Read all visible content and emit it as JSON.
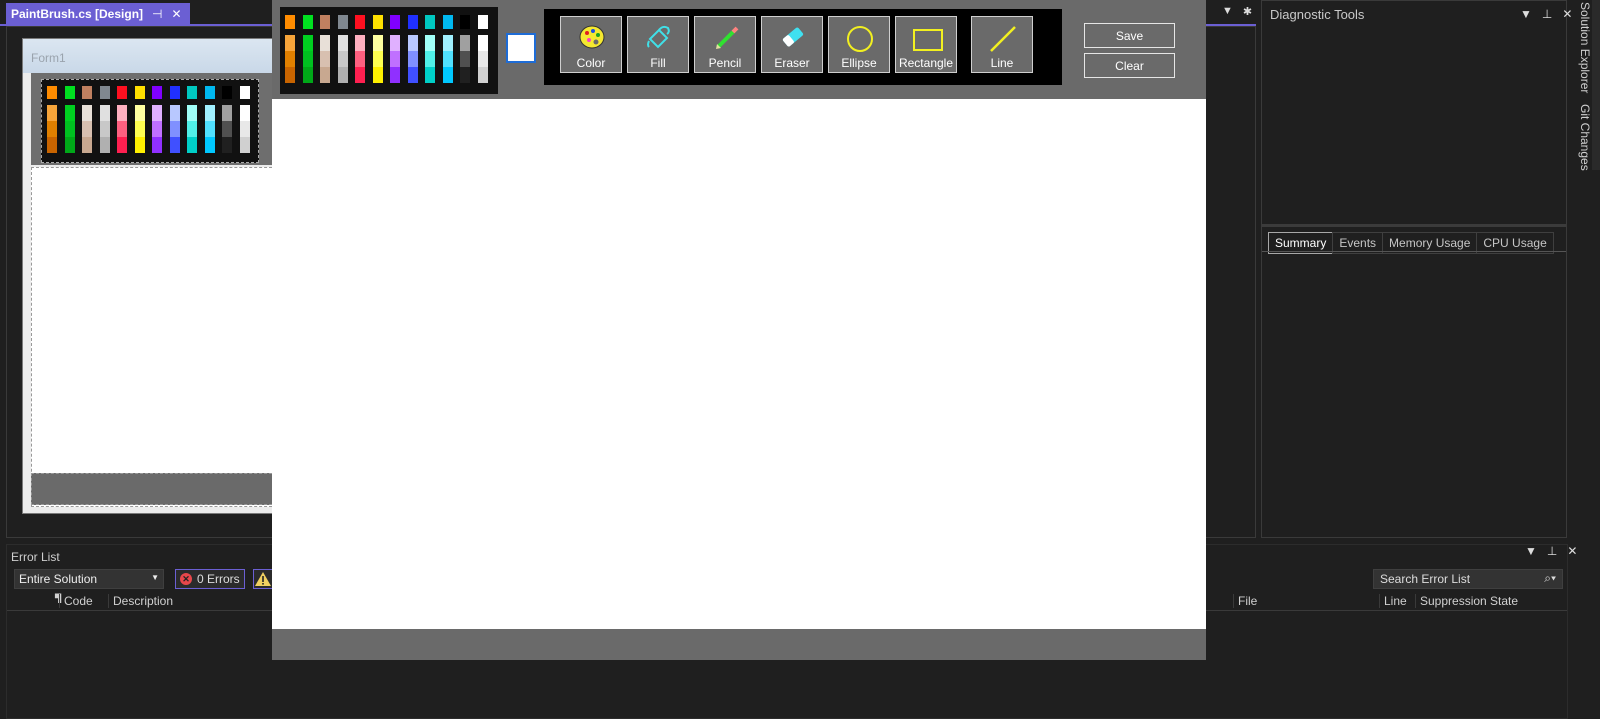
{
  "document_tab": {
    "title": "PaintBrush.cs [Design]",
    "pin": "⊣",
    "close": "✕"
  },
  "designer": {
    "form_title": "Form1"
  },
  "diagnostic": {
    "title": "Diagnostic Tools",
    "tabs": [
      "Summary",
      "Events",
      "Memory Usage",
      "CPU Usage"
    ]
  },
  "side_tabs": [
    "Solution Explorer",
    "Git Changes"
  ],
  "error_list": {
    "title": "Error List",
    "scope": "Entire Solution",
    "errors_label": "0 Errors",
    "search_placeholder": "Search Error List",
    "columns": [
      "Code",
      "Description",
      "File",
      "Line",
      "Suppression State"
    ]
  },
  "paint_app": {
    "tools": [
      {
        "label": "Color",
        "icon": "palette-icon"
      },
      {
        "label": "Fill",
        "icon": "paint-bucket-icon"
      },
      {
        "label": "Pencil",
        "icon": "pencil-icon"
      },
      {
        "label": "Eraser",
        "icon": "eraser-icon"
      },
      {
        "label": "Ellipse",
        "icon": "ellipse-icon"
      },
      {
        "label": "Rectangle",
        "icon": "rectangle-icon"
      },
      {
        "label": "Line",
        "icon": "line-icon"
      }
    ],
    "save_label": "Save",
    "clear_label": "Clear",
    "current_color": "#ffffff",
    "palette": [
      [
        "#ff8c00",
        "#f7a53a",
        "#e08000",
        "#c86400"
      ],
      [
        "#00e020",
        "#00d020",
        "#00c020",
        "#00a818"
      ],
      [
        "#c08060",
        "#e8e0d8",
        "#d8c0b0",
        "#c8a890"
      ],
      [
        "#808890",
        "#e0e0e0",
        "#c8c8c8",
        "#b0b0b0"
      ],
      [
        "#ff1020",
        "#ffb0c0",
        "#ff6080",
        "#ff2050"
      ],
      [
        "#ffe000",
        "#ffffa0",
        "#ffff50",
        "#fff000"
      ],
      [
        "#8000ff",
        "#e0b0ff",
        "#c070ff",
        "#9030ff"
      ],
      [
        "#2030ff",
        "#b8c8ff",
        "#8090ff",
        "#4050ff"
      ],
      [
        "#00c8c0",
        "#a0fff8",
        "#50f0e8",
        "#00d0c8"
      ],
      [
        "#00b8f0",
        "#a0f0ff",
        "#50e0ff",
        "#00c8ff"
      ],
      [
        "#000000",
        "#a0a0a0",
        "#505050",
        "#202020"
      ],
      [
        "#ffffff",
        "#ffffff",
        "#e8e8e8",
        "#d0d0d0"
      ]
    ]
  }
}
